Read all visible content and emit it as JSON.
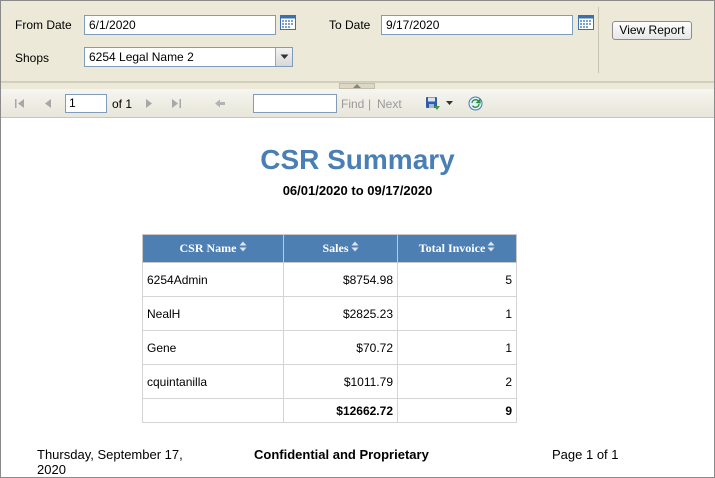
{
  "params": {
    "from_label": "From Date",
    "from_value": "6/1/2020",
    "to_label": "To Date",
    "to_value": "9/17/2020",
    "shops_label": "Shops",
    "shops_value": "6254 Legal Name 2",
    "view_report": "View Report"
  },
  "toolbar": {
    "page_value": "1",
    "of_pages": "of 1",
    "find": "Find",
    "separator": "|",
    "next": "Next",
    "search_value": ""
  },
  "report": {
    "title": "CSR Summary",
    "date_range": "06/01/2020 to 09/17/2020",
    "columns": [
      "CSR Name",
      "Sales",
      "Total Invoice"
    ],
    "rows": [
      {
        "name": "6254Admin",
        "sales": "$8754.98",
        "invoices": "5"
      },
      {
        "name": "NealH",
        "sales": "$2825.23",
        "invoices": "1"
      },
      {
        "name": "Gene",
        "sales": "$70.72",
        "invoices": "1"
      },
      {
        "name": "cquintanilla",
        "sales": "$1011.79",
        "invoices": "2"
      }
    ],
    "total": {
      "name": "",
      "sales": "$12662.72",
      "invoices": "9"
    }
  },
  "footer": {
    "date": "Thursday, September 17, 2020",
    "confidential": "Confidential and Proprietary",
    "page": "Page 1 of 1"
  },
  "colors": {
    "title": "#4a7fb5",
    "header_bg": "#4d7fb3",
    "panel_bg": "#ece9d8"
  }
}
